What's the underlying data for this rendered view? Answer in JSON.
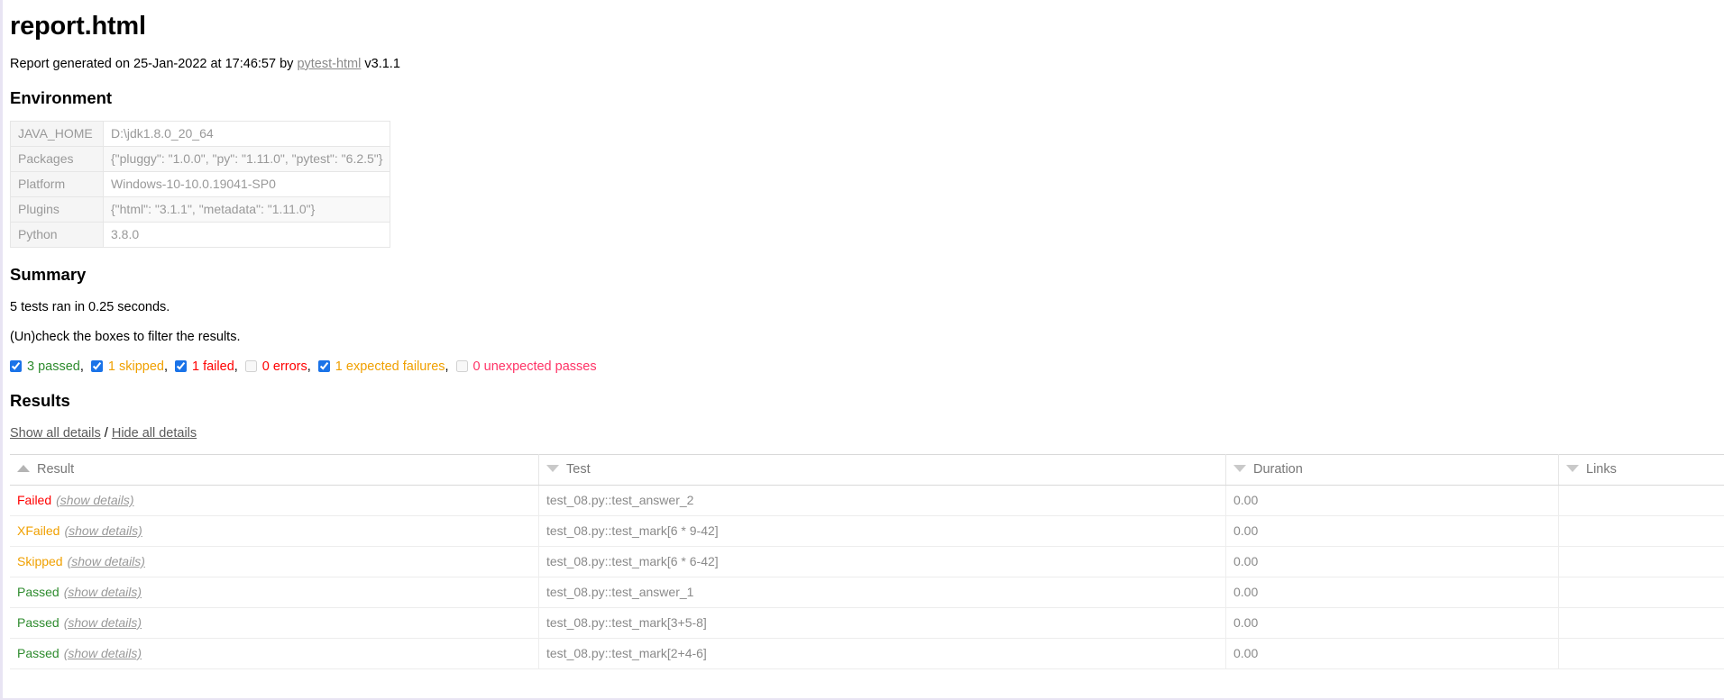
{
  "page": {
    "title": "report.html",
    "generated_prefix": "Report generated on 25-Jan-2022 at 17:46:57 by ",
    "generated_link": "pytest-html",
    "generated_suffix": " v3.1.1"
  },
  "environment": {
    "heading": "Environment",
    "rows": [
      {
        "key": "JAVA_HOME",
        "value": "D:\\jdk1.8.0_20_64"
      },
      {
        "key": "Packages",
        "value": "{\"pluggy\": \"1.0.0\", \"py\": \"1.11.0\", \"pytest\": \"6.2.5\"}"
      },
      {
        "key": "Platform",
        "value": "Windows-10-10.0.19041-SP0"
      },
      {
        "key": "Plugins",
        "value": "{\"html\": \"3.1.1\", \"metadata\": \"1.11.0\"}"
      },
      {
        "key": "Python",
        "value": "3.8.0"
      }
    ]
  },
  "summary": {
    "heading": "Summary",
    "run_line": "5 tests ran in 0.25 seconds.",
    "filter_hint": "(Un)check the boxes to filter the results.",
    "filters": [
      {
        "label": "3 passed",
        "checked": true,
        "enabled": true,
        "color": "#2e8b2e",
        "trailing": ","
      },
      {
        "label": "1 skipped",
        "checked": true,
        "enabled": true,
        "color": "#f0a000",
        "trailing": ","
      },
      {
        "label": "1 failed",
        "checked": true,
        "enabled": true,
        "color": "#ff0000",
        "trailing": ","
      },
      {
        "label": "0 errors",
        "checked": false,
        "enabled": false,
        "color": "#ff0000",
        "trailing": ","
      },
      {
        "label": "1 expected failures",
        "checked": true,
        "enabled": true,
        "color": "#f0a000",
        "trailing": ","
      },
      {
        "label": "0 unexpected passes",
        "checked": false,
        "enabled": false,
        "color": "#ff3366",
        "trailing": ""
      }
    ]
  },
  "results": {
    "heading": "Results",
    "show_all": "Show all details",
    "separator": "/",
    "hide_all": "Hide all details",
    "columns": [
      {
        "label": "Result",
        "sort": "asc"
      },
      {
        "label": "Test",
        "sort": "desc"
      },
      {
        "label": "Duration",
        "sort": "desc"
      },
      {
        "label": "Links",
        "sort": "desc"
      }
    ],
    "show_details_label": "(show details)",
    "rows": [
      {
        "result": "Failed",
        "status": "failed",
        "test": "test_08.py::test_answer_2",
        "duration": "0.00",
        "links": ""
      },
      {
        "result": "XFailed",
        "status": "xfailed",
        "test": "test_08.py::test_mark[6 * 9-42]",
        "duration": "0.00",
        "links": ""
      },
      {
        "result": "Skipped",
        "status": "skipped",
        "test": "test_08.py::test_mark[6 * 6-42]",
        "duration": "0.00",
        "links": ""
      },
      {
        "result": "Passed",
        "status": "passed",
        "test": "test_08.py::test_answer_1",
        "duration": "0.00",
        "links": ""
      },
      {
        "result": "Passed",
        "status": "passed",
        "test": "test_08.py::test_mark[3+5-8]",
        "duration": "0.00",
        "links": ""
      },
      {
        "result": "Passed",
        "status": "passed",
        "test": "test_08.py::test_mark[2+4-6]",
        "duration": "0.00",
        "links": ""
      }
    ]
  }
}
